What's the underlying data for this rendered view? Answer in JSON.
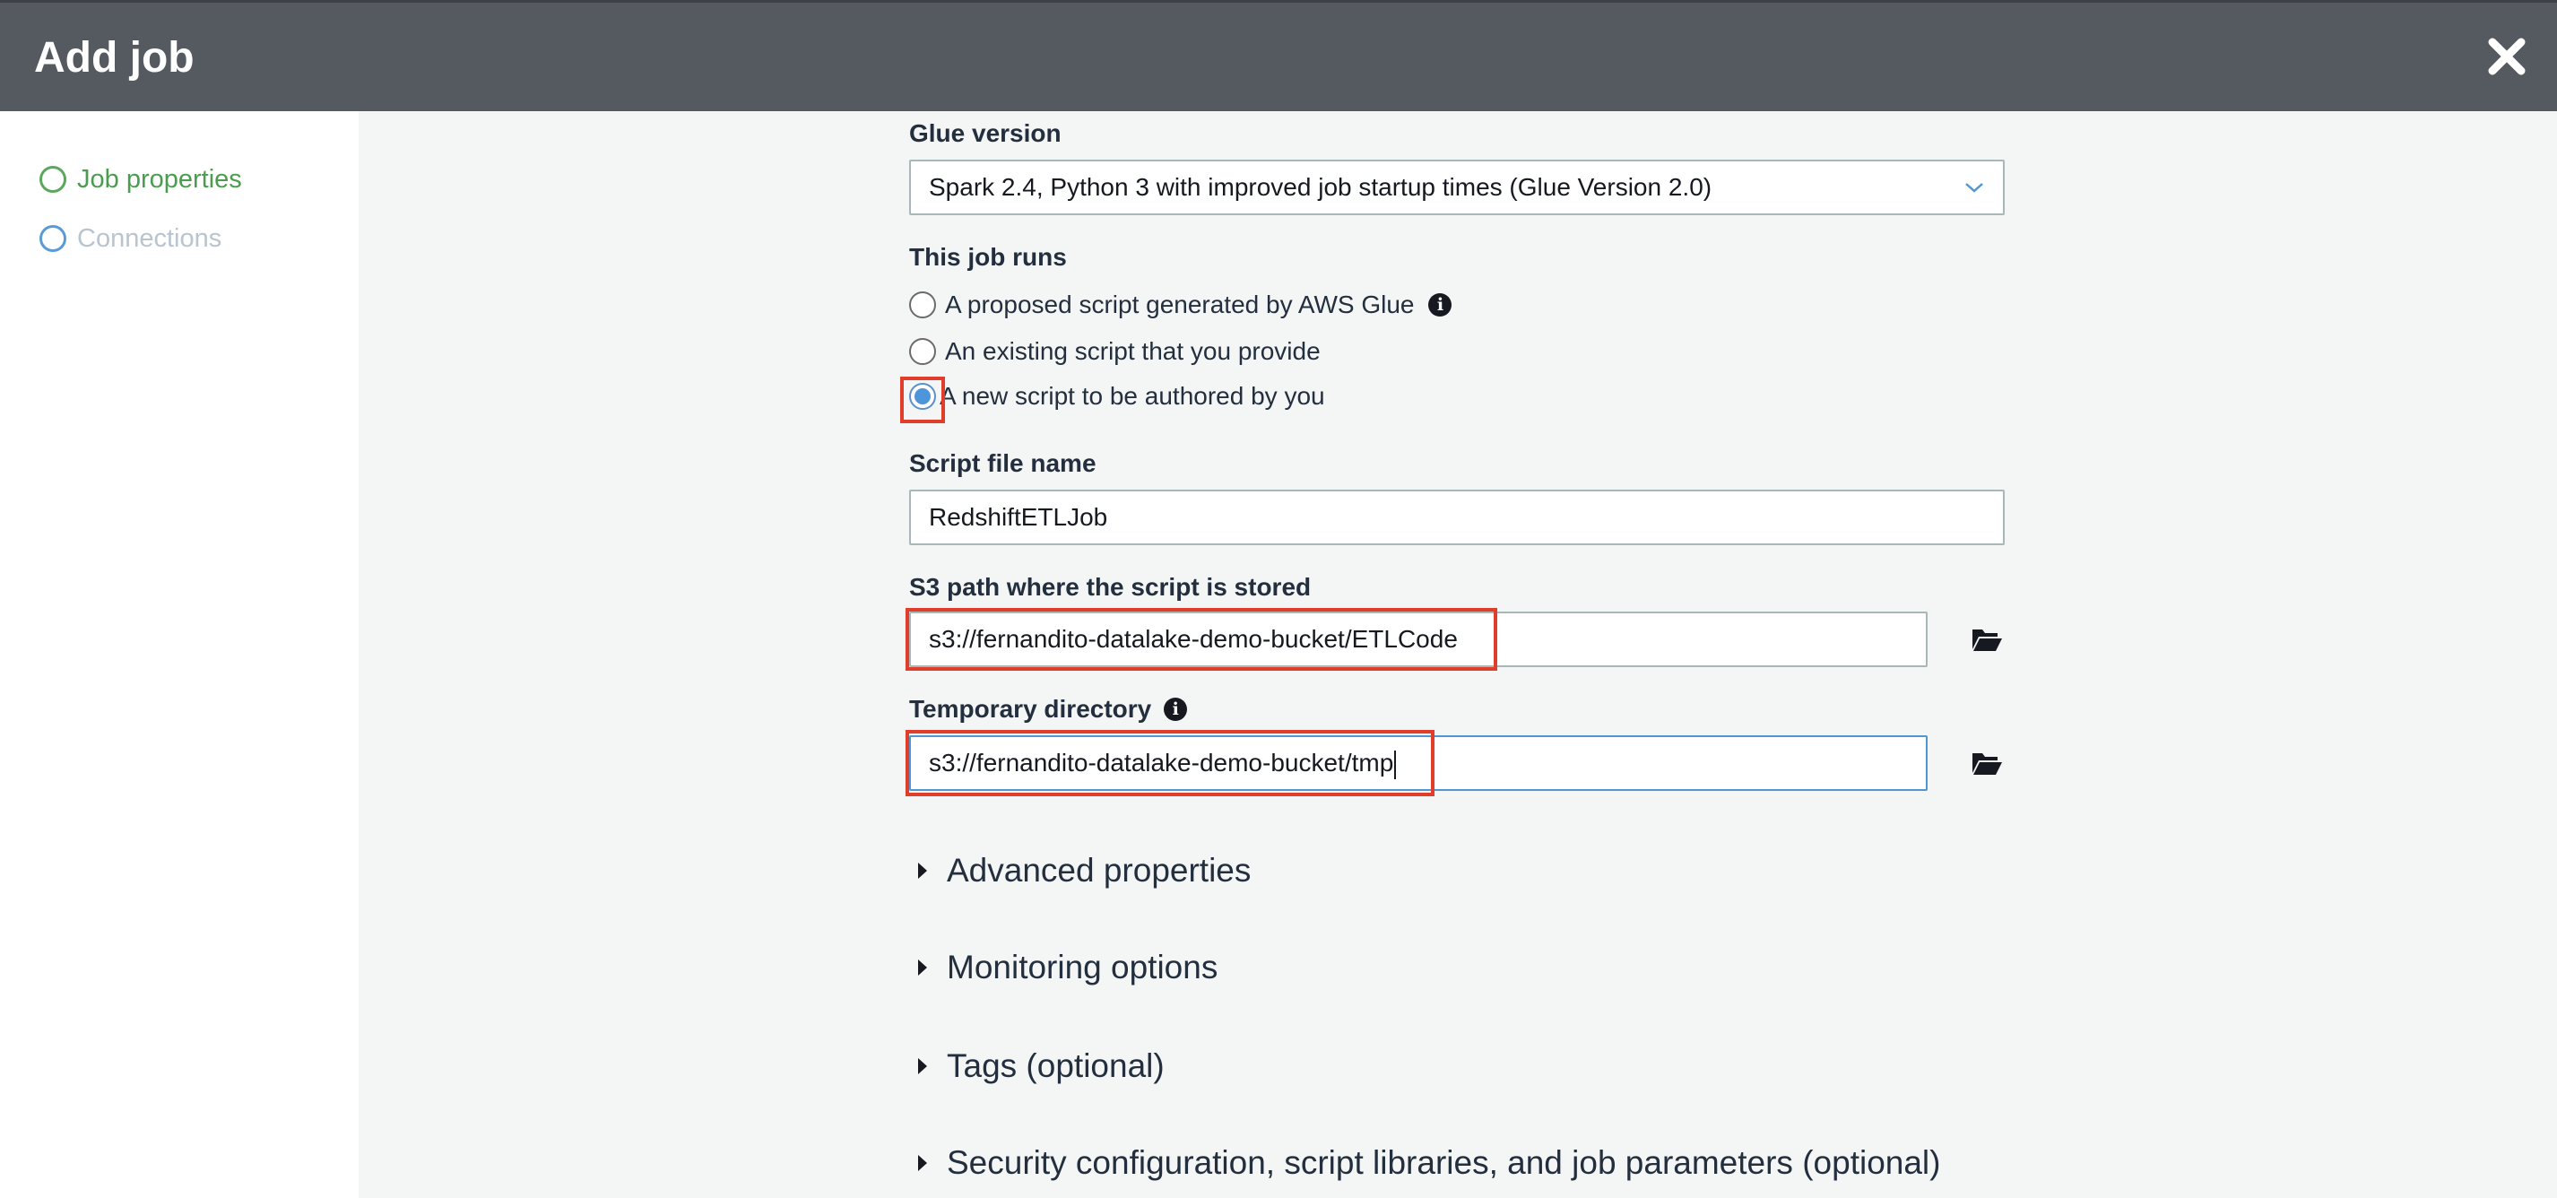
{
  "header": {
    "title": "Add job"
  },
  "sidebar": {
    "steps": [
      {
        "label": "Job properties",
        "state": "active"
      },
      {
        "label": "Connections",
        "state": "pending"
      }
    ]
  },
  "form": {
    "glue_version": {
      "label": "Glue version",
      "selected": "Spark 2.4, Python 3 with improved job startup times (Glue Version 2.0)"
    },
    "job_runs": {
      "label": "This job runs",
      "options": [
        {
          "label": "A proposed script generated by AWS Glue",
          "checked": false
        },
        {
          "label": "An existing script that you provide",
          "checked": false
        },
        {
          "label": "A new script to be authored by you",
          "checked": true
        }
      ]
    },
    "script_file_name": {
      "label": "Script file name",
      "value": "RedshiftETLJob"
    },
    "s3_path": {
      "label": "S3 path where the script is stored",
      "value": "s3://fernandito-datalake-demo-bucket/ETLCode"
    },
    "temp_dir": {
      "label": "Temporary directory",
      "value": "s3://fernandito-datalake-demo-bucket/tmp"
    }
  },
  "sections": [
    {
      "label": "Advanced properties"
    },
    {
      "label": "Monitoring options"
    },
    {
      "label": "Tags (optional)"
    },
    {
      "label": "Security configuration, script libraries, and job parameters (optional)"
    }
  ],
  "colors": {
    "header_bg": "#555a60",
    "active_step": "#4a9d4e",
    "pending_step": "#5a9bd6",
    "radio_checked": "#4f95d9",
    "annotation": "#e03d2b"
  },
  "icons": [
    "close-icon",
    "chevron-down-icon",
    "info-icon",
    "folder-open-icon",
    "caret-right-icon"
  ]
}
